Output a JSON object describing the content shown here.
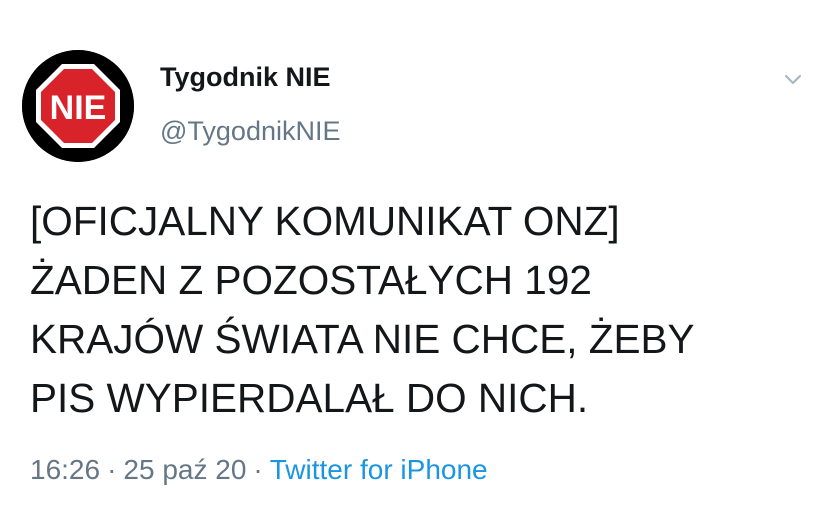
{
  "author": {
    "display_name": "Tygodnik NIE",
    "handle": "@TygodnikNIE",
    "avatar_text": "NIE"
  },
  "tweet": {
    "lines": [
      "[OFICJALNY KOMUNIKAT ONZ]",
      "ŻADEN Z POZOSTAŁYCH 192",
      "KRAJÓW ŚWIATA NIE CHCE, ŻEBY",
      "PIS WYPIERDALAŁ DO NICH."
    ]
  },
  "meta": {
    "time": "16:26",
    "date": "25 paź 20",
    "separator": "·",
    "source": "Twitter for iPhone"
  },
  "icons": {
    "menu": "chevron-down-icon",
    "avatar": "stop-sign-icon"
  },
  "colors": {
    "name_text": "#14171a",
    "secondary_text": "#657786",
    "link": "#1b95e0",
    "avatar_red": "#d8232a",
    "avatar_bg": "#000000"
  }
}
